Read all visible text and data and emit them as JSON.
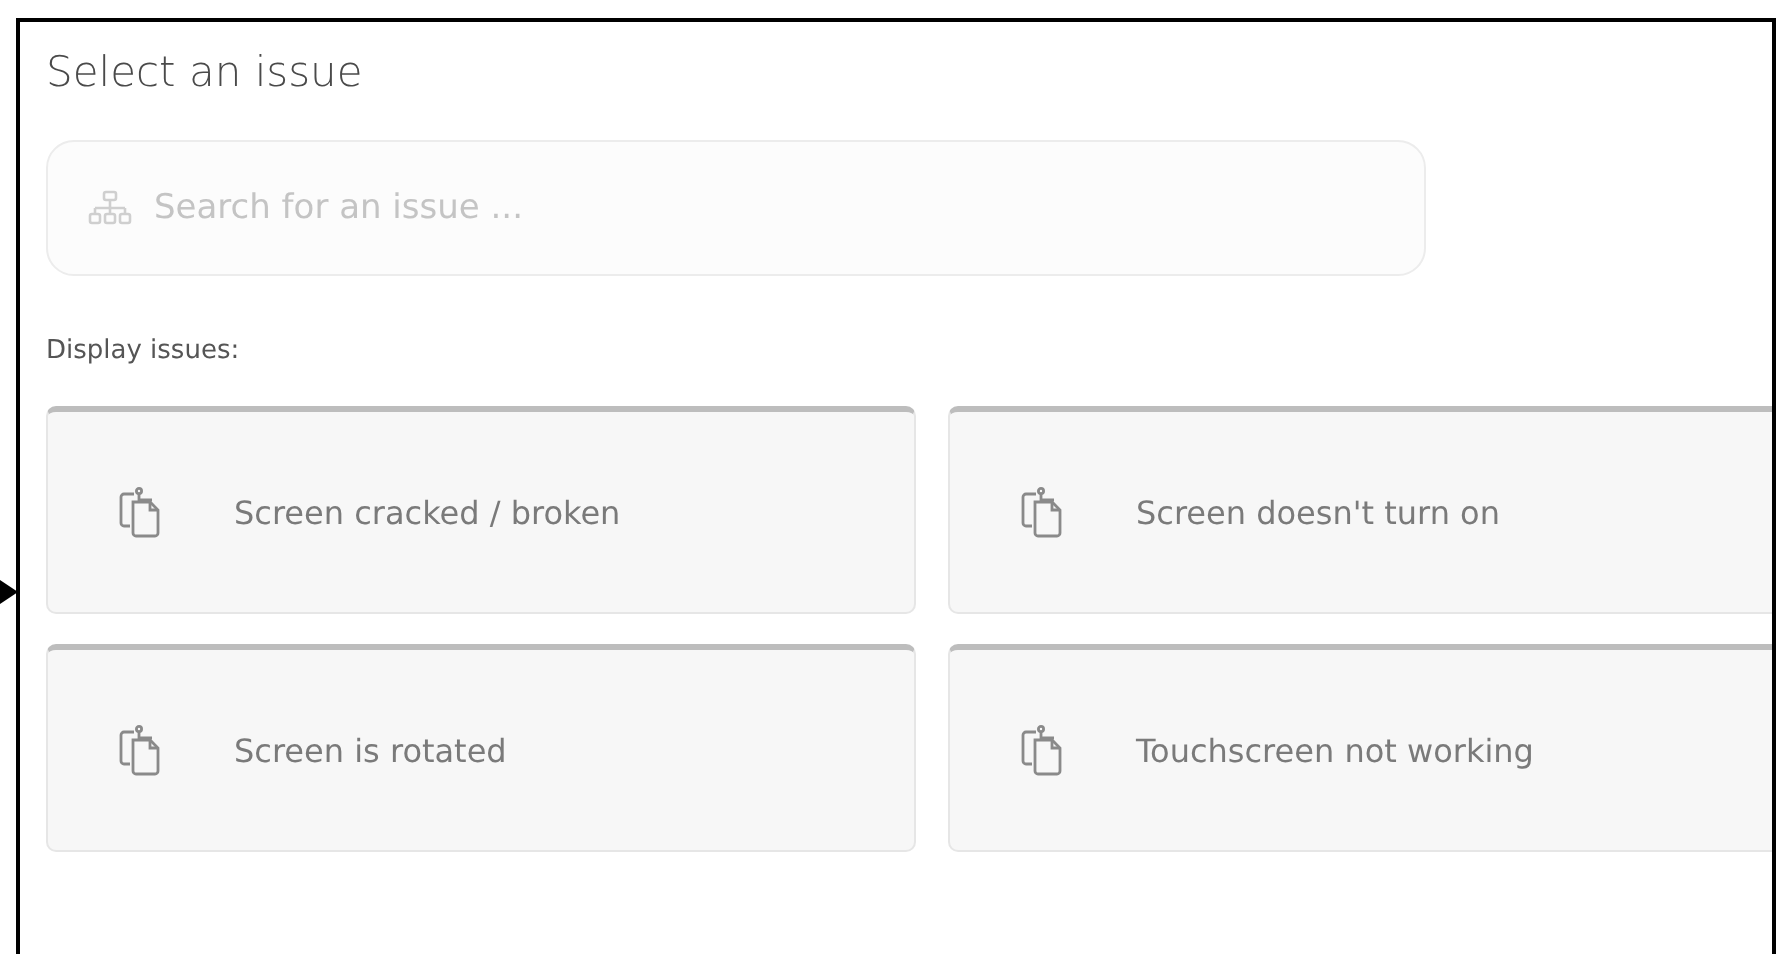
{
  "title": "Select an issue",
  "search": {
    "placeholder": "Search for an issue ..."
  },
  "section_label": "Display issues:",
  "issues": [
    {
      "label": "Screen cracked / broken"
    },
    {
      "label": "Screen doesn't turn on"
    },
    {
      "label": "Screen is rotated"
    },
    {
      "label": "Touchscreen not working"
    }
  ]
}
